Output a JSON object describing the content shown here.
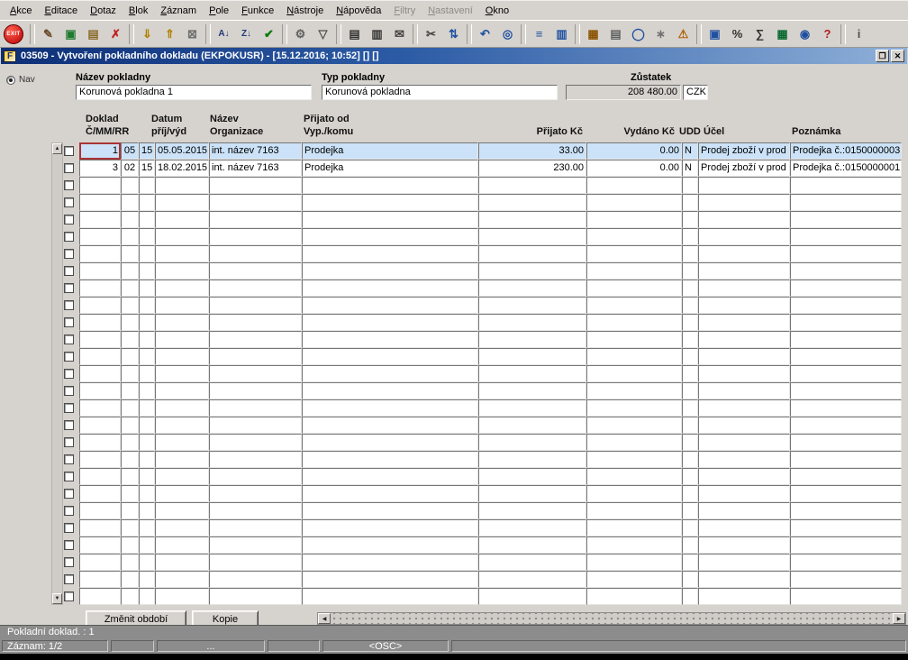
{
  "menu": {
    "items": [
      {
        "label": "Akce",
        "enabled": true
      },
      {
        "label": "Editace",
        "enabled": true
      },
      {
        "label": "Dotaz",
        "enabled": true
      },
      {
        "label": "Blok",
        "enabled": true
      },
      {
        "label": "Záznam",
        "enabled": true
      },
      {
        "label": "Pole",
        "enabled": true
      },
      {
        "label": "Funkce",
        "enabled": true
      },
      {
        "label": "Nástroje",
        "enabled": true
      },
      {
        "label": "Nápověda",
        "enabled": true
      },
      {
        "label": "Filtry",
        "enabled": false
      },
      {
        "label": "Nastavení",
        "enabled": false
      },
      {
        "label": "Okno",
        "enabled": true
      }
    ]
  },
  "toolbar": {
    "icons": [
      {
        "name": "exit-button",
        "glyph": "EXIT",
        "kind": "exit"
      },
      {
        "sep": true
      },
      {
        "name": "print-edit-icon",
        "glyph": "✎",
        "color": "#6b4a2a"
      },
      {
        "name": "import-document-icon",
        "glyph": "▣",
        "color": "#1f7a2f"
      },
      {
        "name": "export-document-icon",
        "glyph": "▤",
        "color": "#8a6a2a"
      },
      {
        "name": "delete-record-icon",
        "glyph": "✗",
        "color": "#c02020"
      },
      {
        "sep": true
      },
      {
        "name": "copy-record-icon",
        "glyph": "⇓",
        "color": "#b08000"
      },
      {
        "name": "duplicate-record-icon",
        "glyph": "⇑",
        "color": "#b08000"
      },
      {
        "name": "clear-record-icon",
        "glyph": "⊠",
        "color": "#707070"
      },
      {
        "sep": true
      },
      {
        "name": "sort-asc-icon",
        "glyph": "A↓",
        "color": "#223a7a",
        "small": true
      },
      {
        "name": "sort-desc-icon",
        "glyph": "Z↓",
        "color": "#223a7a",
        "small": true
      },
      {
        "name": "commit-icon",
        "glyph": "✔",
        "color": "#0a7a0a"
      },
      {
        "sep": true
      },
      {
        "name": "tools-icon",
        "glyph": "⚙",
        "color": "#606060"
      },
      {
        "name": "filter-icon",
        "glyph": "▽",
        "color": "#505050"
      },
      {
        "sep": true
      },
      {
        "name": "print-icon",
        "glyph": "▤",
        "color": "#303030"
      },
      {
        "name": "print-preview-icon",
        "glyph": "▥",
        "color": "#303030"
      },
      {
        "name": "mail-icon",
        "glyph": "✉",
        "color": "#404040"
      },
      {
        "sep": true
      },
      {
        "name": "cut-icon",
        "glyph": "✂",
        "color": "#404040"
      },
      {
        "name": "reorder-icon",
        "glyph": "⇅",
        "color": "#2050a0"
      },
      {
        "sep": true
      },
      {
        "name": "undo-icon",
        "glyph": "↶",
        "color": "#2050a0"
      },
      {
        "name": "search-icon",
        "glyph": "◎",
        "color": "#2050a0"
      },
      {
        "sep": true
      },
      {
        "name": "list-of-values-icon",
        "glyph": "≡",
        "color": "#2050a0"
      },
      {
        "name": "detail-view-icon",
        "glyph": "▥",
        "color": "#2050a0"
      },
      {
        "sep": true
      },
      {
        "name": "calendar-icon",
        "glyph": "▦",
        "color": "#8a5200"
      },
      {
        "name": "document-icon",
        "glyph": "▤",
        "color": "#606060"
      },
      {
        "name": "globe-icon",
        "glyph": "◯",
        "color": "#2050a0"
      },
      {
        "name": "settings-icon",
        "glyph": "∗",
        "color": "#707070"
      },
      {
        "name": "warning-icon",
        "glyph": "⚠",
        "color": "#b06000"
      },
      {
        "sep": true
      },
      {
        "name": "window-icon",
        "glyph": "▣",
        "color": "#2050a0"
      },
      {
        "name": "percent-icon",
        "glyph": "%",
        "color": "#303030"
      },
      {
        "name": "sum-icon",
        "glyph": "∑",
        "color": "#303030"
      },
      {
        "name": "excel-export-icon",
        "glyph": "▦",
        "color": "#0a6a30"
      },
      {
        "name": "browser-icon",
        "glyph": "◉",
        "color": "#2050a0"
      },
      {
        "name": "help-icon",
        "glyph": "?",
        "color": "#b02020"
      },
      {
        "sep": true
      },
      {
        "name": "info-icon",
        "glyph": "i",
        "color": "#505050"
      }
    ]
  },
  "titlebar": {
    "title": "03509 - Vytvoření pokladního dokladu (EKPOKUSR) - [15.12.2016; 10:52]  []  []",
    "app_icon_letter": "F",
    "restore_glyph": "❐",
    "close_glyph": "✕"
  },
  "nav": {
    "label": "Nav"
  },
  "form": {
    "nazev_label": "Název pokladny",
    "nazev_value": "Korunová pokladna 1",
    "typ_label": "Typ pokladny",
    "typ_value": "Korunová pokladna",
    "zustatek_label": "Zůstatek",
    "zustatek_value": "208 480.00",
    "currency": "CZK"
  },
  "table": {
    "headers": {
      "doklad1": "Doklad",
      "doklad2": "Č/MM/RR",
      "datum1": "Datum",
      "datum2": "příj/výd",
      "nazev1": "Název",
      "nazev2": "Organizace",
      "prijato_od1": "Přijato od",
      "prijato_od2": "Vyp./komu",
      "prijato_kc": "Přijato Kč",
      "vydano_kc": "Vydáno Kč",
      "udd": "UDD",
      "ucel": "Účel",
      "poznamka": "Poznámka"
    },
    "rows": [
      {
        "doklad": "1",
        "mm": "05",
        "rr": "15",
        "datum": "05.05.2015",
        "organizace": "int. název 7163",
        "prijato_od": "Prodejka",
        "prijato_kc": "33.00",
        "vydano_kc": "0.00",
        "udd": "N",
        "ucel": "Prodej zboží v prod",
        "poznamka": "Prodejka č.:0150000003",
        "selected": true,
        "current": true
      },
      {
        "doklad": "3",
        "mm": "02",
        "rr": "15",
        "datum": "18.02.2015",
        "organizace": "int. název 7163",
        "prijato_od": "Prodejka",
        "prijato_kc": "230.00",
        "vydano_kc": "0.00",
        "udd": "N",
        "ucel": "Prodej zboží v prod",
        "poznamka": "Prodejka č.:0150000001",
        "selected": false,
        "current": false
      }
    ],
    "total_rows": 27
  },
  "buttons": {
    "zmenit_obdobi": "Změnit období",
    "kopie": "Kopie"
  },
  "status": {
    "message": "Pokladní doklad. : 1",
    "zaznam": "Záznam: 1/2",
    "dots": "...",
    "osc": "<OSC>"
  }
}
